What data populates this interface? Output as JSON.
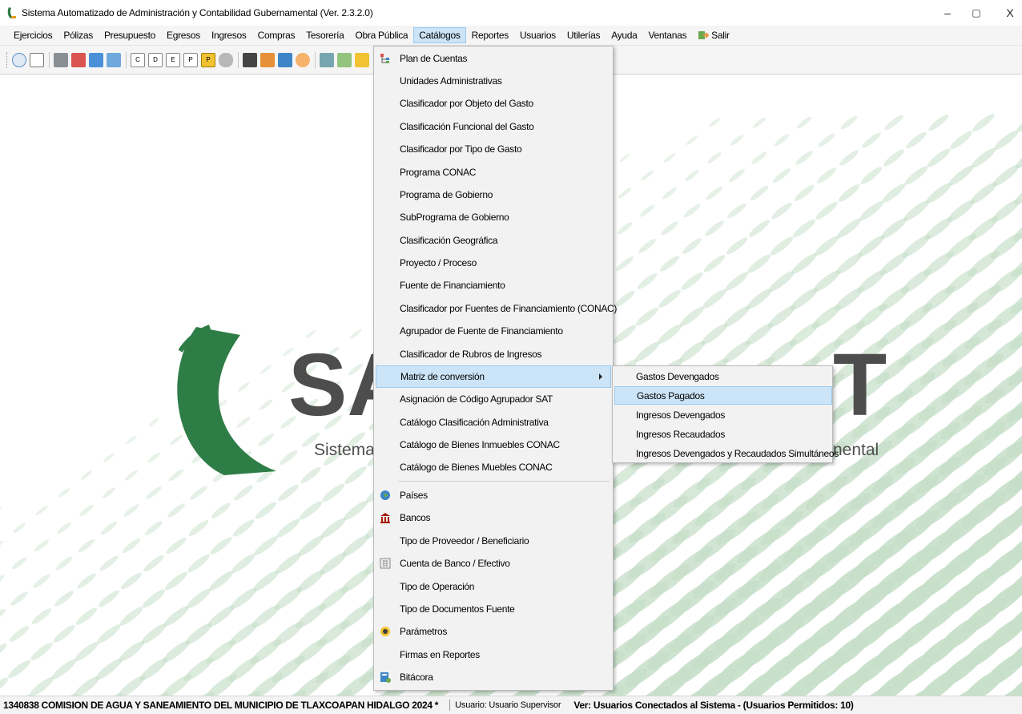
{
  "window": {
    "title": "Sistema Automatizado de Administración y Contabilidad Gubernamental  (Ver. 2.3.2.0)",
    "minimize": "–",
    "maximize": "▢",
    "close": "X"
  },
  "menubar": {
    "items": [
      "Ejercicios",
      "Pólizas",
      "Presupuesto",
      "Egresos",
      "Ingresos",
      "Compras",
      "Tesorería",
      "Obra Pública",
      "Catálogos",
      "Reportes",
      "Usuarios",
      "Utilerías",
      "Ayuda",
      "Ventanas",
      "Salir"
    ],
    "active": "Catálogos"
  },
  "toolbar": {
    "icons": [
      "refresh-icon",
      "report-icon",
      "printer-icon",
      "transfer-icon",
      "download-icon",
      "calculator-icon",
      "c-icon",
      "d-icon",
      "e-icon",
      "p-icon",
      "p-gold-icon",
      "print-icon",
      "clipboard-icon",
      "edit-icon",
      "chart-icon",
      "package-icon",
      "notes-icon",
      "tools-icon",
      "layers-icon",
      "tree-icon",
      "coin-icon",
      "book-icon",
      "tree2-icon"
    ]
  },
  "logo": {
    "letters_left": "SA",
    "letters_right": "T",
    "subtitle_left": "Sistema",
    "subtitle_right": "nental"
  },
  "catalog_menu": {
    "items": [
      {
        "label": "Plan de Cuentas",
        "icon": "tree-icon"
      },
      {
        "label": "Unidades Administrativas"
      },
      {
        "label": "Clasificador por Objeto del Gasto"
      },
      {
        "label": "Clasificación Funcional del Gasto"
      },
      {
        "label": "Clasificador por Tipo de Gasto"
      },
      {
        "label": "Programa CONAC"
      },
      {
        "label": "Programa de Gobierno"
      },
      {
        "label": "SubPrograma de Gobierno"
      },
      {
        "label": "Clasificación Geográfica"
      },
      {
        "label": "Proyecto / Proceso"
      },
      {
        "label": "Fuente de Financiamiento"
      },
      {
        "label": "Clasificador por Fuentes de Financiamiento (CONAC)"
      },
      {
        "label": "Agrupador de Fuente de Financiamiento"
      },
      {
        "label": "Clasificador de Rubros de Ingresos"
      },
      {
        "label": "Matriz de conversión",
        "submenu": true,
        "highlighted": true
      },
      {
        "label": "Asignación de Código Agrupador SAT"
      },
      {
        "label": "Catálogo Clasificación Administrativa"
      },
      {
        "label": "Catálogo de Bienes Inmuebles CONAC"
      },
      {
        "label": "Catálogo de Bienes Muebles CONAC"
      },
      {
        "label": "Países",
        "icon": "globe-icon"
      },
      {
        "label": "Bancos",
        "icon": "bank-icon"
      },
      {
        "label": "Tipo de Proveedor / Beneficiario"
      },
      {
        "label": "Cuenta de Banco / Efectivo",
        "icon": "calculator-icon"
      },
      {
        "label": "Tipo de Operación"
      },
      {
        "label": "Tipo de Documentos Fuente"
      },
      {
        "label": "Parámetros",
        "icon": "settings-icon"
      },
      {
        "label": "Firmas en Reportes"
      },
      {
        "label": "Bitácora",
        "icon": "log-icon"
      }
    ]
  },
  "submenu": {
    "items": [
      "Gastos Devengados",
      "Gastos Pagados",
      "Ingresos Devengados",
      "Ingresos Recaudados",
      "Ingresos Devengados y Recaudados Simultáneos"
    ],
    "highlighted": "Gastos Pagados"
  },
  "statusbar": {
    "company": "1340838 COMISION DE AGUA Y SANEAMIENTO DEL MUNICIPIO DE TLAXCOAPAN HIDALGO  2024   *",
    "user": "Usuario: Usuario Supervisor",
    "connected": "Ver: Usuarios Conectados al Sistema - (Usuarios Permitidos: 10)"
  },
  "colors": {
    "accent_green": "#2e7d46",
    "stripe_green": "#c4dcc6",
    "highlight": "#cce4f7",
    "highlight_border": "#99c9ef"
  }
}
